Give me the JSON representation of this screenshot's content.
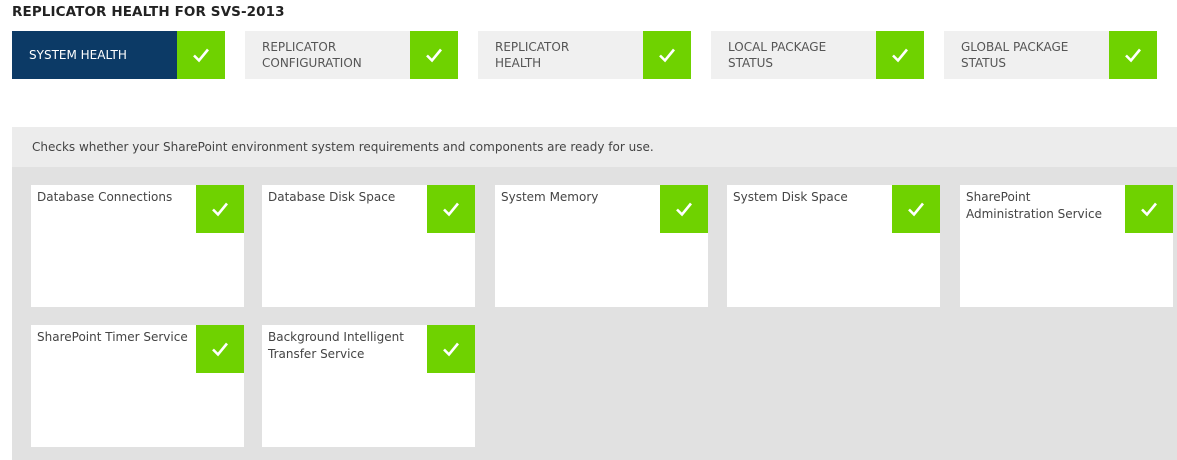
{
  "page": {
    "title": "REPLICATOR HEALTH FOR SVS-2013"
  },
  "colors": {
    "active_tab": "#0c3a66",
    "tab_bg": "#f0f0f0",
    "status_ok": "#6fd200",
    "panel_bg": "#e1e1e1",
    "desc_bg": "#ececec"
  },
  "tabs": [
    {
      "label": "SYSTEM HEALTH",
      "active": true,
      "status_icon": "check-icon"
    },
    {
      "label": "REPLICATOR\nCONFIGURATION",
      "active": false,
      "status_icon": "check-icon"
    },
    {
      "label": "REPLICATOR\nHEALTH",
      "active": false,
      "status_icon": "check-icon"
    },
    {
      "label": "LOCAL PACKAGE\nSTATUS",
      "active": false,
      "status_icon": "check-icon"
    },
    {
      "label": "GLOBAL PACKAGE\nSTATUS",
      "active": false,
      "status_icon": "check-icon"
    }
  ],
  "panel": {
    "description": "Checks whether your SharePoint environment system requirements and components are ready for use."
  },
  "checks": [
    {
      "label": "Database Connections",
      "status_icon": "check-icon"
    },
    {
      "label": "Database Disk Space",
      "status_icon": "check-icon"
    },
    {
      "label": "System Memory",
      "status_icon": "check-icon"
    },
    {
      "label": "System Disk Space",
      "status_icon": "check-icon"
    },
    {
      "label": "SharePoint Administration Service",
      "status_icon": "check-icon"
    },
    {
      "label": "SharePoint Timer Service",
      "status_icon": "check-icon"
    },
    {
      "label": "Background Intelligent Transfer Service",
      "status_icon": "check-icon"
    }
  ]
}
